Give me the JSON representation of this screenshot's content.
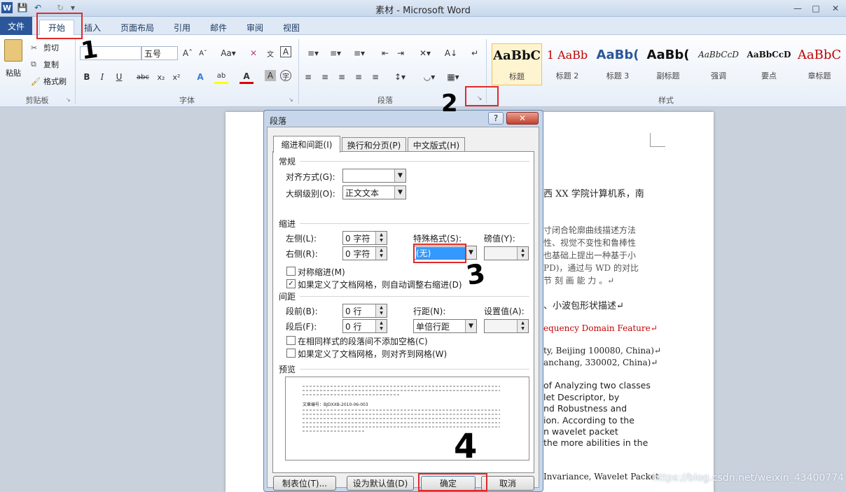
{
  "window": {
    "title": "素材 - Microsoft Word"
  },
  "tabs": [
    "文件",
    "开始",
    "插入",
    "页面布局",
    "引用",
    "邮件",
    "审阅",
    "视图"
  ],
  "clipboard": {
    "paste": "粘贴",
    "cut": "剪切",
    "copy": "复制",
    "format_painter": "格式刷",
    "label": "剪贴板"
  },
  "font": {
    "name": "",
    "size": "五号",
    "label": "字体"
  },
  "paragraph": {
    "label": "段落"
  },
  "styles": {
    "label": "样式",
    "items": [
      {
        "sample": "AaBbC",
        "name": "标题"
      },
      {
        "sample": "1  AaBb",
        "name": "标题 2"
      },
      {
        "sample": "AaBb(",
        "name": "标题 3"
      },
      {
        "sample": "AaBb(",
        "name": "副标题"
      },
      {
        "sample": "AaBbCcD",
        "name": "强调"
      },
      {
        "sample": "AaBbCcD",
        "name": "要点"
      },
      {
        "sample": "AaBbC",
        "name": "章标题"
      }
    ]
  },
  "document": {
    "lines": [
      "西 XX 学院计算机系，南",
      "寸闭合轮廓曲线描述方法",
      "性、视觉不变性和鲁棒性",
      "也基础上提出一种基于小",
      "PD)，通过与 WD 的对比",
      "节 刻 画 能 力 。↵",
      "、小波包形状描述↵",
      "equency Domain Feature↵",
      "ty, Beijing 100080, China)↵",
      "anchang, 330002, China)↵",
      "of Analyzing two classes",
      "let Descriptor, by",
      "nd Robustness and",
      "ion. According to the",
      "n wavelet packet",
      "the more abilities in the",
      "Invariance, Wavelet Packet"
    ]
  },
  "dialog": {
    "title": "段落",
    "help": "?",
    "tabs": [
      "缩进和间距(I)",
      "换行和分页(P)",
      "中文版式(H)"
    ],
    "general": {
      "section": "常规",
      "alignment_label": "对齐方式(G):",
      "alignment_value": "",
      "outline_label": "大纲级别(O):",
      "outline_value": "正文文本"
    },
    "indent": {
      "section": "缩进",
      "left_label": "左侧(L):",
      "left_value": "0 字符",
      "right_label": "右侧(R):",
      "right_value": "0 字符",
      "special_label": "特殊格式(S):",
      "special_value": "(无)",
      "by_label": "磅值(Y):",
      "by_value": "",
      "mirror": "对称缩进(M)",
      "auto_adjust": "如果定义了文档网格，则自动调整右缩进(D)"
    },
    "spacing": {
      "section": "间距",
      "before_label": "段前(B):",
      "before_value": "0 行",
      "after_label": "段后(F):",
      "after_value": "0 行",
      "line_label": "行距(N):",
      "line_value": "单倍行距",
      "at_label": "设置值(A):",
      "at_value": "",
      "no_space": "在相同样式的段落间不添加空格(C)",
      "snap_grid": "如果定义了文档网格，则对齐到网格(W)"
    },
    "preview": {
      "section": "预览",
      "sample_text": "文章编号：BJDXXB-2010-06-003"
    },
    "buttons": {
      "tabs": "制表位(T)...",
      "default": "设为默认值(D)",
      "ok": "确定",
      "cancel": "取消"
    }
  },
  "annotations": [
    "1",
    "2",
    "3",
    "4"
  ],
  "watermark": "https://blog.csdn.net/weixin_43400774",
  "colors": {
    "accent": "#2b579a",
    "annotation": "#e02a2a"
  }
}
